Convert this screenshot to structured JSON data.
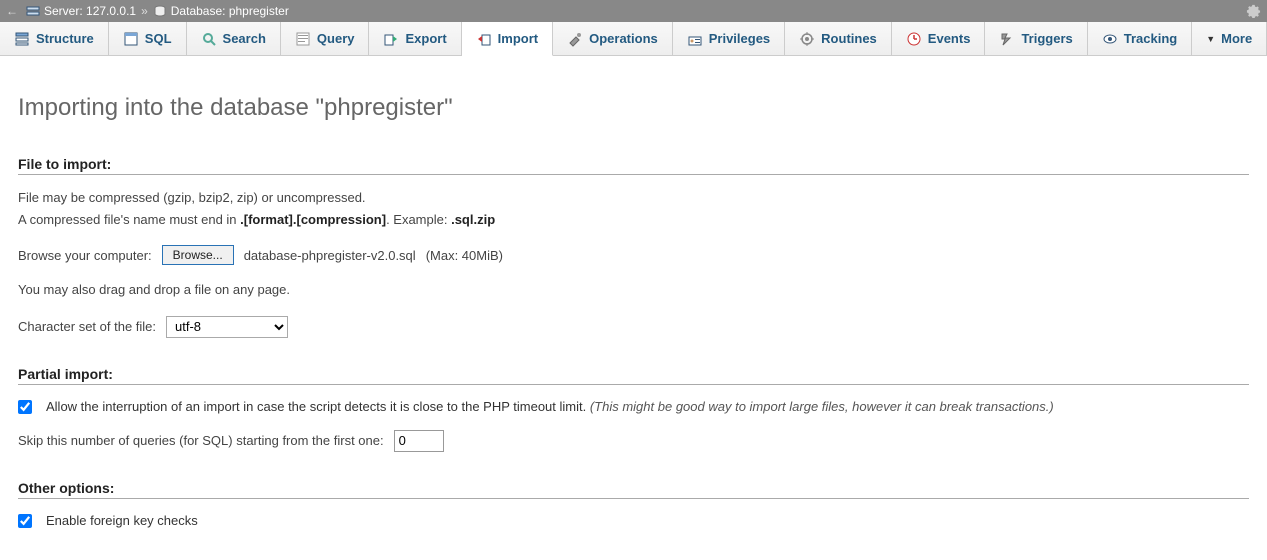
{
  "breadcrumb": {
    "server_label": "Server:",
    "server_value": "127.0.0.1",
    "database_label": "Database:",
    "database_value": "phpregister"
  },
  "tabs": {
    "structure": "Structure",
    "sql": "SQL",
    "search": "Search",
    "query": "Query",
    "export": "Export",
    "import": "Import",
    "operations": "Operations",
    "privileges": "Privileges",
    "routines": "Routines",
    "events": "Events",
    "triggers": "Triggers",
    "tracking": "Tracking",
    "more": "More"
  },
  "page_title": "Importing into the database \"phpregister\"",
  "file_section": {
    "title": "File to import:",
    "line1": "File may be compressed (gzip, bzip2, zip) or uncompressed.",
    "line2a": "A compressed file's name must end in ",
    "line2b": ".[format].[compression]",
    "line2c": ". Example: ",
    "line2d": ".sql.zip",
    "browse_label": "Browse your computer:",
    "browse_btn": "Browse...",
    "filename": "database-phpregister-v2.0.sql",
    "max": "(Max: 40MiB)",
    "dragdrop": "You may also drag and drop a file on any page.",
    "charset_label": "Character set of the file:",
    "charset_value": "utf-8"
  },
  "partial_section": {
    "title": "Partial import:",
    "allow_text": "Allow the interruption of an import in case the script detects it is close to the PHP timeout limit. ",
    "allow_hint": "(This might be good way to import large files, however it can break transactions.)",
    "skip_label": "Skip this number of queries (for SQL) starting from the first one:",
    "skip_value": "0"
  },
  "other_section": {
    "title": "Other options:",
    "fk_label": "Enable foreign key checks"
  }
}
